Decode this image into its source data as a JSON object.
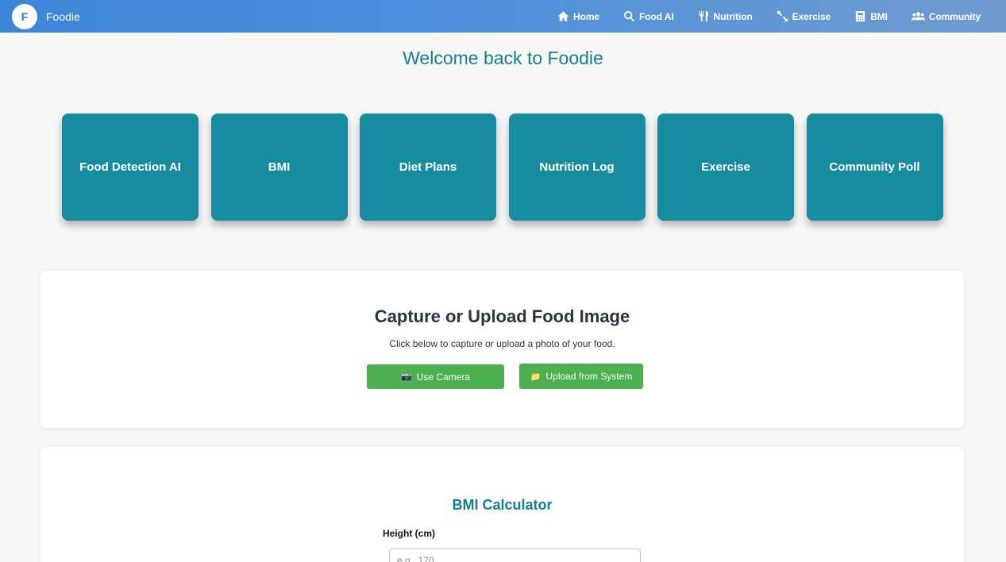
{
  "brand": {
    "logo_letter": "F",
    "name": "Foodie"
  },
  "nav": [
    {
      "label": "Home",
      "icon": "home-icon"
    },
    {
      "label": "Food AI",
      "icon": "search-icon"
    },
    {
      "label": "Nutrition",
      "icon": "utensils-icon"
    },
    {
      "label": "Exercise",
      "icon": "expand-arrows-icon"
    },
    {
      "label": "BMI",
      "icon": "calculator-icon"
    },
    {
      "label": "Community",
      "icon": "users-icon"
    }
  ],
  "welcome": "Welcome back to Foodie",
  "cards": [
    "Food Detection AI",
    "BMI",
    "Diet Plans",
    "Nutrition Log",
    "Exercise",
    "Community Poll"
  ],
  "upload": {
    "title": "Capture or Upload Food Image",
    "description": "Click below to capture or upload a photo of your food.",
    "camera_button": "Use Camera",
    "camera_icon": "📷",
    "upload_button": "Upload from System",
    "upload_icon": "📁"
  },
  "bmi": {
    "title": "BMI Calculator",
    "height_label": "Height (cm)",
    "height_placeholder": "e.g., 170"
  },
  "colors": {
    "nav_gradient_start": "#3d85d8",
    "nav_gradient_end": "#6f9bd0",
    "card": "#178ba0",
    "accent_text": "#147f8e",
    "button": "#4caf50"
  }
}
